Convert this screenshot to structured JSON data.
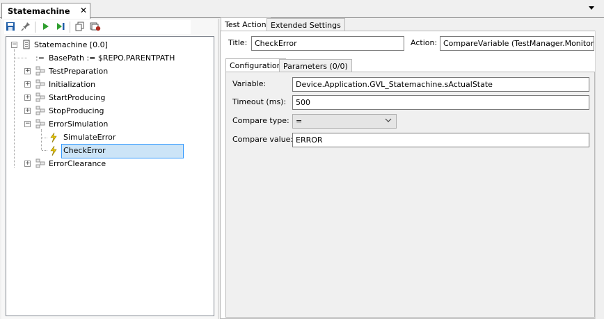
{
  "tab": {
    "title": "Statemachine",
    "close": "✕"
  },
  "tree": {
    "root": "Statemachine [0.0]",
    "base_path": "BasePath := $REPO.PARENTPATH",
    "items": [
      {
        "label": "TestPreparation",
        "expander": "+"
      },
      {
        "label": "Initialization",
        "expander": "+"
      },
      {
        "label": "StartProducing",
        "expander": "+"
      },
      {
        "label": "StopProducing",
        "expander": "+"
      },
      {
        "label": "ErrorSimulation",
        "expander": "−"
      },
      {
        "label": "SimulateError"
      },
      {
        "label": "CheckError"
      },
      {
        "label": "ErrorClearance",
        "expander": "+"
      }
    ],
    "root_expander": "−"
  },
  "right": {
    "tabs": [
      "Test Action",
      "Extended Settings"
    ],
    "title_label": "Title:",
    "title_value": "CheckError",
    "action_label": "Action:",
    "action_value": "CompareVariable (TestManager.Monitoring)",
    "subtabs": [
      "Configuration",
      "Parameters (0/0)"
    ],
    "variable_label": "Variable:",
    "variable_value": "Device.Application.GVL_Statemachine.sActualState",
    "timeout_label": "Timeout (ms):",
    "timeout_value": "500",
    "compare_type_label": "Compare type:",
    "compare_type_value": "=",
    "compare_value_label": "Compare value:",
    "compare_value_value": "ERROR"
  },
  "colors": {
    "selection_bg": "#cce4f7",
    "selection_border": "#3399ff",
    "save_icon": "#1f5ea8",
    "run_icon": "#2e9e2e"
  }
}
